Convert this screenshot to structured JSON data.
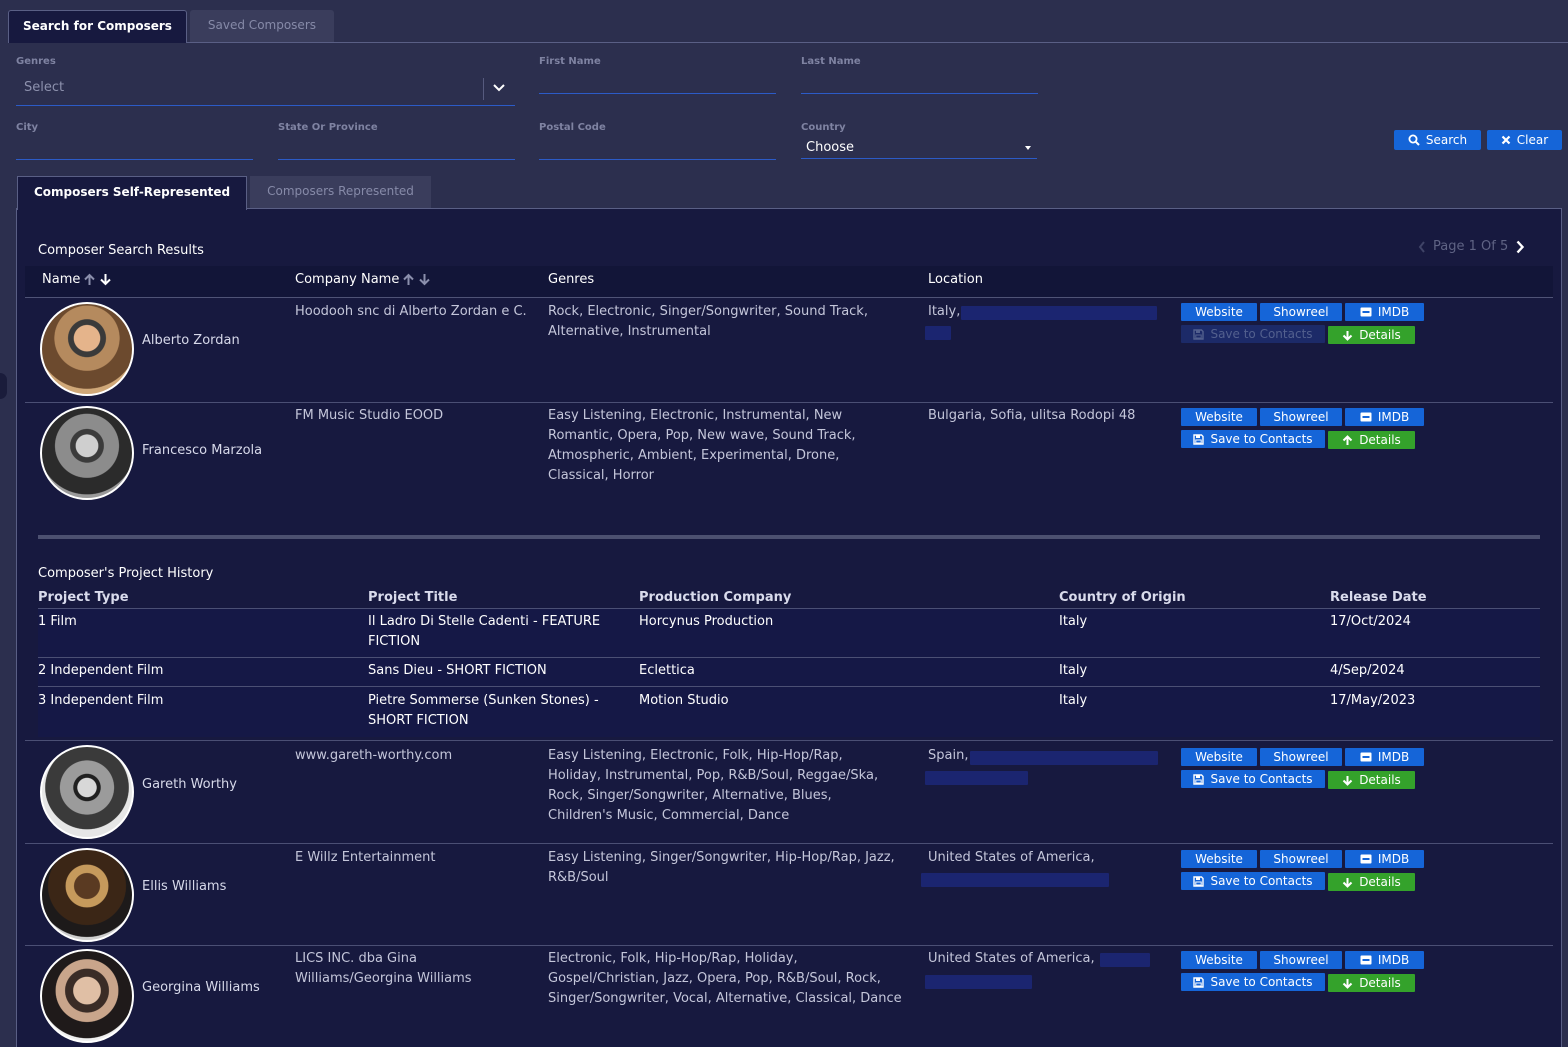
{
  "tabs": {
    "active": "Search for Composers",
    "inactive": "Saved Composers"
  },
  "filters": {
    "genres_label": "Genres",
    "genres_placeholder": "Select",
    "first_name_label": "First Name",
    "last_name_label": "Last Name",
    "city_label": "City",
    "state_label": "State Or Province",
    "postal_label": "Postal Code",
    "country_label": "Country",
    "country_value": "Choose",
    "search_label": "Search",
    "clear_label": "Clear"
  },
  "subtabs": {
    "active": "Composers Self-Represented",
    "inactive": "Composers Represented"
  },
  "results": {
    "title": "Composer Search Results",
    "pager": "Page 1 Of 5",
    "headers": {
      "name": "Name",
      "company": "Company Name",
      "genres": "Genres",
      "location": "Location"
    }
  },
  "buttons": {
    "website": "Website",
    "showreel": "Showreel",
    "imdb": "IMDB",
    "save": "Save to Contacts",
    "details": "Details"
  },
  "composers": [
    {
      "name": "Alberto Zordan",
      "company": "Hoodooh snc di Alberto Zordan e C.",
      "genres": "Rock, Electronic, Singer/Songwriter, Sound Track, Alternative, Instrumental",
      "location": "Italy,"
    },
    {
      "name": "Francesco Marzola",
      "company": "FM Music Studio EOOD",
      "genres": "Easy Listening, Electronic, Instrumental, New Romantic, Opera, Pop, New wave, Sound Track, Atmospheric, Ambient, Experimental, Drone, Classical, Horror",
      "location": "Bulgaria, Sofia, ulitsa Rodopi 48"
    },
    {
      "name": "Gareth Worthy",
      "company": "www.gareth-worthy.com",
      "genres": "Easy Listening, Electronic, Folk, Hip-Hop/Rap, Holiday, Instrumental, Pop, R&B/Soul, Reggae/Ska, Rock, Singer/Songwriter, Alternative, Blues, Children's Music, Commercial, Dance",
      "location": "Spain,"
    },
    {
      "name": "Ellis Williams",
      "company": "E Willz Entertainment",
      "genres": "Easy Listening, Singer/Songwriter, Hip-Hop/Rap, Jazz, R&B/Soul",
      "location": "United States of America,"
    },
    {
      "name": "Georgina Williams",
      "company": "LICS INC. dba Gina Williams/Georgina Williams",
      "genres": "Electronic, Folk, Hip-Hop/Rap, Holiday, Gospel/Christian, Jazz, Opera, Pop, R&B/Soul, Rock, Singer/Songwriter, Vocal, Alternative, Classical, Dance",
      "location": "United States of America,"
    }
  ],
  "project_history": {
    "title": "Composer's Project History",
    "headers": {
      "type": "Project Type",
      "title": "Project Title",
      "company": "Production Company",
      "country": "Country of Origin",
      "date": "Release Date"
    },
    "rows": [
      {
        "type": "1 Film",
        "title": "Il Ladro Di Stelle Cadenti - FEATURE FICTION",
        "company": "Horcynus Production",
        "country": "Italy",
        "date": "17/Oct/2024"
      },
      {
        "type": "2 Independent Film",
        "title": "Sans Dieu - SHORT FICTION",
        "company": "Eclettica",
        "country": "Italy",
        "date": "4/Sep/2024"
      },
      {
        "type": "3 Independent Film",
        "title": "Pietre Sommerse (Sunken Stones) - SHORT FICTION",
        "company": "Motion Studio",
        "country": "Italy",
        "date": "17/May/2023"
      }
    ]
  },
  "colors": {
    "background": "#2c2f4e",
    "panel": "#17193f",
    "accent": "#1565d8",
    "details_green": "#34a22b",
    "input_line": "#2c5bc7"
  },
  "icons": [
    "chevron-down-icon",
    "caret-down-icon",
    "search-icon",
    "close-icon",
    "sort-up-icon",
    "sort-down-icon",
    "chevron-left-icon",
    "chevron-right-icon",
    "imdb-icon",
    "save-icon",
    "arrow-down-icon",
    "arrow-up-icon"
  ]
}
